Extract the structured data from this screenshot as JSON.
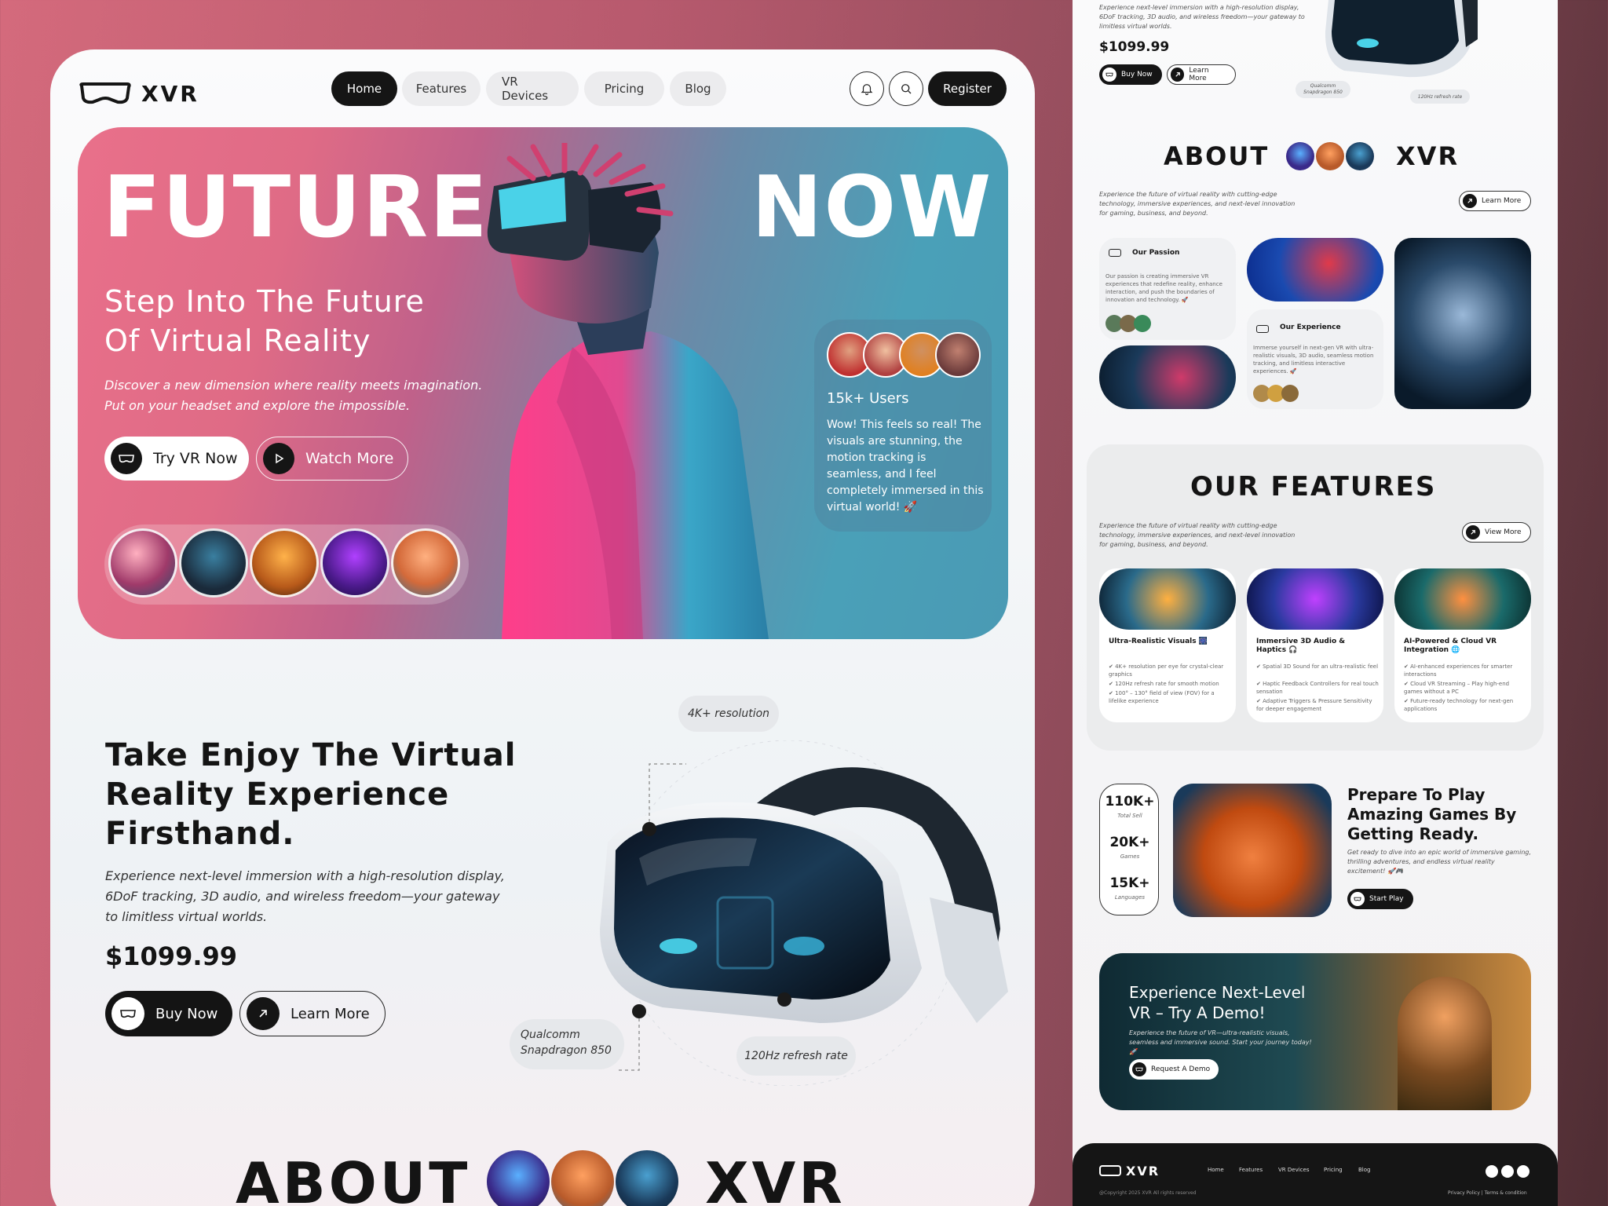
{
  "brand": {
    "name": "XVR"
  },
  "nav": {
    "items": [
      {
        "label": "Home",
        "active": true
      },
      {
        "label": "Features"
      },
      {
        "label": "VR Devices"
      },
      {
        "label": "Pricing"
      },
      {
        "label": "Blog"
      }
    ],
    "register_label": "Register",
    "icons": [
      "bell-icon",
      "search-icon"
    ]
  },
  "hero": {
    "word_left": "FUTURE",
    "word_right": "NOW",
    "subtitle_line1": "Step Into The Future",
    "subtitle_line2": "Of Virtual Reality",
    "para_line1": "Discover a new dimension where reality meets imagination.",
    "para_line2": "Put on your headset and explore the impossible.",
    "try_label": "Try VR Now",
    "watch_label": "Watch More",
    "testimonial": {
      "users": "15k+ Users",
      "quote": "Wow! This feels so real! The visuals are stunning, the motion tracking is seamless, and I feel completely immersed in this virtual world! 🚀"
    }
  },
  "product": {
    "heading_line1": "Take Enjoy The Virtual",
    "heading_line2": "Reality Experience",
    "heading_line3": "Firsthand.",
    "desc_line1": "Experience next-level immersion with a high-resolution display,",
    "desc_line2": "6DoF tracking, 3D audio, and wireless freedom—your gateway",
    "desc_line3": "to limitless virtual worlds.",
    "price": "$1099.99",
    "buy_label": "Buy Now",
    "learn_label": "Learn More",
    "spec_resolution": "4K+ resolution",
    "spec_chip_line1": "Qualcomm",
    "spec_chip_line2": "Snapdragon 850",
    "spec_refresh": "120Hz refresh rate"
  },
  "about": {
    "word1": "ABOUT",
    "word2": "XVR"
  },
  "right": {
    "top_desc": "Experience next-level immersion with a high-resolution display, 6DoF tracking, 3D audio, and wireless freedom—your gateway to limitless virtual worlds.",
    "price": "$1099.99",
    "buy_label": "Buy Now",
    "learn_label": "Learn More",
    "chip_label": "Qualcomm Snapdragon 850",
    "refresh_label": "120Hz refresh rate",
    "about_word1": "ABOUT",
    "about_word2": "XVR",
    "about_desc": "Experience the future of virtual reality with cutting-edge technology, immersive experiences, and next-level innovation for gaming, business, and beyond.",
    "about_learn": "Learn More",
    "passion_title": "Our Passion",
    "passion_text": "Our passion is creating immersive VR experiences that redefine reality, enhance interaction, and push the boundaries of innovation and technology. 🚀",
    "experience_title": "Our Experience",
    "experience_text": "Immerse yourself in next-gen VR with ultra-realistic visuals, 3D audio, seamless motion tracking, and limitless interactive experiences. 🚀",
    "features_title": "OUR FEATURES",
    "features_desc": "Experience the future of virtual reality with cutting-edge technology, immersive experiences, and next-level innovation for gaming, business, and beyond.",
    "features_view": "View More",
    "features": [
      {
        "title": "Ultra-Realistic Visuals 🎆",
        "points": [
          "✔ 4K+ resolution per eye for crystal-clear graphics",
          "✔ 120Hz refresh rate for smooth motion",
          "✔ 100° – 130° field of view (FOV) for a lifelike experience"
        ]
      },
      {
        "title": "Immersive 3D Audio & Haptics 🎧",
        "points": [
          "✔ Spatial 3D Sound for an ultra-realistic feel",
          "✔ Haptic Feedback Controllers for real touch sensation",
          "✔ Adaptive Triggers & Pressure Sensitivity for deeper engagement"
        ]
      },
      {
        "title": "AI-Powered & Cloud VR Integration 🌐",
        "points": [
          "✔ AI-enhanced experiences for smarter interactions",
          "✔ Cloud VR Streaming – Play high-end games without a PC",
          "✔ Future-ready technology for next-gen applications"
        ]
      }
    ],
    "stats": [
      {
        "value": "110K+",
        "label": "Total Sell"
      },
      {
        "value": "20K+",
        "label": "Games"
      },
      {
        "value": "15K+",
        "label": "Languages"
      }
    ],
    "games_title_line1": "Prepare To Play",
    "games_title_line2": "Amazing Games By",
    "games_title_line3": "Getting Ready.",
    "games_desc": "Get ready to dive into an epic world of immersive gaming, thrilling adventures, and endless virtual reality excitement! 🚀🎮",
    "games_button": "Start Play",
    "demo_title_line1": "Experience Next-Level",
    "demo_title_line2": "VR – Try A Demo!",
    "demo_desc": "Experience the future of VR—ultra-realistic visuals, seamless and immersive sound. Start your journey today! 🚀",
    "demo_button": "Request A Demo",
    "footer_brand": "XVR",
    "footer_links": [
      "Home",
      "Features",
      "VR Devices",
      "Pricing",
      "Blog"
    ],
    "footer_copy": "@Copyright 2025 XVR All rights reserved",
    "footer_legal": "Privacy Policy  |  Terms & condition"
  },
  "colors": {
    "accent_dark": "#151515",
    "hero_pink": "#e9708a",
    "hero_teal": "#4aa0b8"
  }
}
